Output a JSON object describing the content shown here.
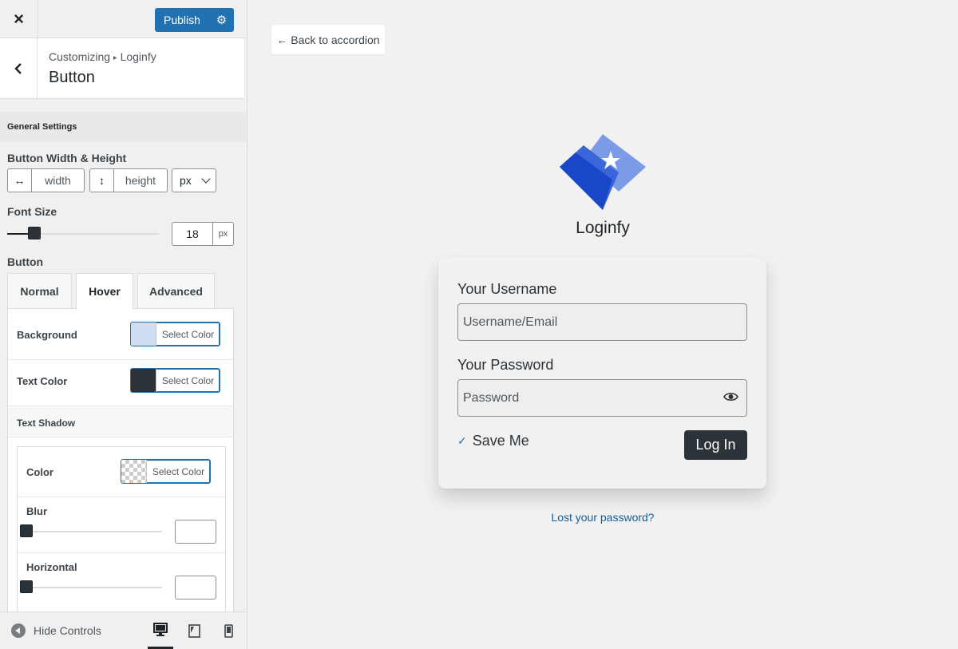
{
  "topbar": {
    "close_icon": "×",
    "publish_label": "Publish",
    "settings_icon": "⚙"
  },
  "section": {
    "breadcrumb_prefix": "Customizing",
    "breadcrumb_arrow": "▸",
    "breadcrumb_current": "Loginfy",
    "title": "Button"
  },
  "general_settings": {
    "heading": "General Settings"
  },
  "button_size": {
    "label": "Button Width & Height",
    "width_icon": "↔",
    "width_placeholder": "width",
    "height_icon": "↕",
    "height_placeholder": "height",
    "unit": "px"
  },
  "font_size": {
    "label": "Font Size",
    "value": "18",
    "unit": "px",
    "slider_level": 0.18
  },
  "button_group": {
    "label": "Button",
    "tabs": [
      {
        "label": "Normal",
        "active": false
      },
      {
        "label": "Hover",
        "active": true
      },
      {
        "label": "Advanced",
        "active": false
      }
    ]
  },
  "hover_panel": {
    "background": {
      "label": "Background",
      "button_label": "Select Color",
      "color": "#cfdef2"
    },
    "text_color": {
      "label": "Text Color",
      "button_label": "Select Color",
      "color": "#2c3338"
    },
    "text_shadow": {
      "heading": "Text Shadow",
      "color": {
        "label": "Color",
        "button_label": "Select Color",
        "color": "transparent"
      },
      "blur": {
        "label": "Blur",
        "value": "",
        "slider_level": 0
      },
      "horizontal": {
        "label": "Horizontal",
        "value": "",
        "slider_level": 0
      }
    }
  },
  "footer": {
    "hide_controls": "Hide Controls",
    "devices": [
      {
        "name": "desktop",
        "active": true
      },
      {
        "name": "tablet",
        "active": false
      },
      {
        "name": "mobile",
        "active": false
      }
    ]
  },
  "preview": {
    "back_link": "← Back to accordion",
    "brand_name": "Loginfy",
    "username_label": "Your Username",
    "username_placeholder": "Username/Email",
    "password_label": "Your Password",
    "password_placeholder": "Password",
    "remember_check": "✓",
    "remember_label": "Save Me",
    "login_button": "Log In",
    "lost_password": "Lost your password?",
    "colors": {
      "logo_dark": "#1a47c8",
      "logo_mid": "#3a66d9",
      "logo_light": "#7b9be6",
      "link": "#135e96",
      "button": "#2c3338"
    }
  }
}
